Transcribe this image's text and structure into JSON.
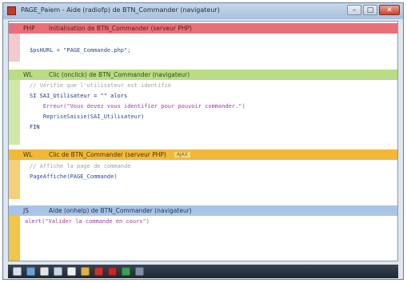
{
  "window": {
    "title": "PAGE_Paiem - Aide (radiofp) de BTN_Commander (navigateur)",
    "buttons": {
      "minimize": "–",
      "maximize": "□",
      "close": "✕"
    }
  },
  "sections": {
    "php_init": {
      "tag": "PHP",
      "title": "Initialisation de BTN_Commander (serveur PHP)",
      "lines": [
        "$psHURL = \"PAGE_Commande.php\";"
      ]
    },
    "wl_click": {
      "tag": "WL",
      "title": "Clic (onclick) de BTN_Commander (navigateur)",
      "lines": [
        "// Vérifie que l'utilisateur est identifié",
        "SI SAI_Utilisateur = \"\" alors",
        "    Erreur(\"Vous devez vous identifier pour pouvoir commander.\")",
        "    RepriseSaisie(SAI_Utilisateur)",
        "FIN"
      ]
    },
    "wl_server": {
      "tag": "WL",
      "title": "Clic de BTN_Commander (serveur PHP)",
      "badge": "AJAX",
      "lines": [
        "// Affiche la page de commande",
        "PageAffiche(PAGE_Commande)"
      ]
    },
    "js_click": {
      "tag": "JS",
      "title": "Aide (onhelp) de BTN_Commander (navigateur)",
      "lines": [
        "alert(\"Valider la commande en cours\")"
      ]
    }
  },
  "taskbar": {
    "icons": [
      {
        "name": "start-icon",
        "color": "#d9e2ee"
      },
      {
        "name": "explorer-icon",
        "color": "#6aa1d8"
      },
      {
        "name": "document-icon",
        "color": "#e6e6e6"
      },
      {
        "name": "windev-icon",
        "color": "#c9d6e6"
      },
      {
        "name": "page-icon",
        "color": "#f0f0f0"
      },
      {
        "name": "code-icon",
        "color": "#e0b040"
      },
      {
        "name": "stop-icon",
        "color": "#d03030"
      },
      {
        "name": "red-app-icon",
        "color": "#c02828"
      },
      {
        "name": "green-app-icon",
        "color": "#3aa04a"
      },
      {
        "name": "dots-icon",
        "color": "#8090a4"
      }
    ]
  }
}
